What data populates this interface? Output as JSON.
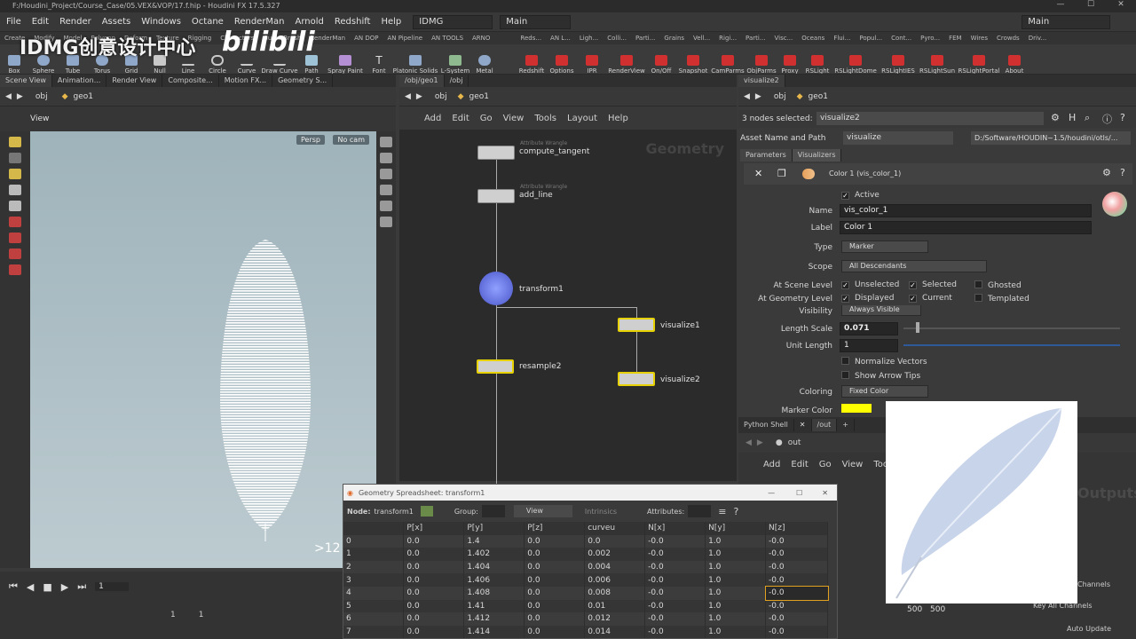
{
  "window": {
    "title": "F:/Houdini_Project/Course_Case/05.VEX&VOP/17.f.hip - Houdini FX 17.5.327",
    "controls": [
      "—",
      "☐",
      "✕"
    ]
  },
  "menubar": {
    "items": [
      "File",
      "Edit",
      "Render",
      "Assets",
      "Windows",
      "Octane",
      "RenderMan",
      "Arnold",
      "Redshift",
      "Help"
    ],
    "desktop": "IDMG",
    "workspace": "Main",
    "right_workspace": "Main"
  },
  "watermark": {
    "left": "IDMG创意设计中心",
    "right": "bilibili"
  },
  "shelf_tabs_left": [
    "Create",
    "Modify",
    "Model",
    "Polygon",
    "Deform",
    "Texture",
    "Rigging",
    "Characters",
    "Guide Brush",
    "RenderMan",
    "AN DOP",
    "AN Pipeline",
    "AN TOOLS",
    "ARNO"
  ],
  "shelf_tabs_right": [
    "Reds...",
    "AN L...",
    "Ligh...",
    "Colli...",
    "Parti...",
    "Grains",
    "Vell...",
    "Rigi...",
    "Parti...",
    "Visc...",
    "Oceans",
    "Flui...",
    "Popul...",
    "Cont...",
    "Pyro...",
    "FEM",
    "Wires",
    "Crowds",
    "Driv..."
  ],
  "shelf_tools_left": [
    "Box",
    "Sphere",
    "Tube",
    "Torus",
    "Grid",
    "Null",
    "Line",
    "Circle",
    "Curve",
    "Draw Curve",
    "Path",
    "Spray Paint",
    "Font",
    "Platonic Solids",
    "L-System",
    "Metal"
  ],
  "shelf_tools_right": [
    "Redshift",
    "Options",
    "IPR",
    "RenderView",
    "On/Off",
    "Snapshot",
    "CamParms",
    "ObjParms",
    "Proxy",
    "RSLight",
    "RSLightDome",
    "RSLightIES",
    "RSLightSun",
    "RSLightPortal",
    "About"
  ],
  "left_pane": {
    "tabs": [
      "Scene View",
      "Animation...",
      "Render View",
      "Composite...",
      "Motion FX...",
      "Geometry S..."
    ],
    "path": [
      "obj",
      "geo1"
    ],
    "view_label": "View",
    "persp": "Persp",
    "cam": "No cam",
    "frame_hint": ">12"
  },
  "node_pane": {
    "tabs": [
      "/obj/geo1",
      "/obj"
    ],
    "path": [
      "obj",
      "geo1"
    ],
    "menu": [
      "Add",
      "Edit",
      "Go",
      "View",
      "Tools",
      "Layout",
      "Help"
    ],
    "context": "Geometry",
    "nodes": [
      {
        "name": "compute_tangent",
        "sub": "Attribute Wrangle"
      },
      {
        "name": "add_line",
        "sub": "Attribute Wrangle"
      },
      {
        "name": "transform1",
        "sub": ""
      },
      {
        "name": "visualize1",
        "sub": ""
      },
      {
        "name": "resample2",
        "sub": ""
      },
      {
        "name": "visualize2",
        "sub": ""
      }
    ]
  },
  "params": {
    "tabs": [
      "visualize2"
    ],
    "path": [
      "obj",
      "geo1"
    ],
    "selected": "3 nodes selected:",
    "selected_node": "visualize2",
    "asset_label": "Asset Name and Path",
    "asset_name": "visualize",
    "asset_path": "D:/Software/HOUDIN~1.5/houdini/otls/...",
    "subtabs": [
      "Parameters",
      "Visualizers"
    ],
    "visualizer": "Color 1 (vis_color_1)",
    "active": "Active",
    "name_label": "Name",
    "name_value": "vis_color_1",
    "label_label": "Label",
    "label_value": "Color 1",
    "type_label": "Type",
    "type_value": "Marker",
    "scope_label": "Scope",
    "scope_value": "All Descendants",
    "scene_label": "At Scene Level",
    "geo_label": "At Geometry Level",
    "checks_scene": [
      "Unselected",
      "Selected",
      "Ghosted"
    ],
    "checks_geo": [
      "Displayed",
      "Current",
      "Templated"
    ],
    "visibility_label": "Visibility",
    "visibility_value": "Always Visible",
    "length_label": "Length Scale",
    "length_value": "0.071",
    "unit_label": "Unit Length",
    "unit_value": "1",
    "normalize": "Normalize Vectors",
    "arrow": "Show Arrow Tips",
    "coloring_label": "Coloring",
    "coloring_value": "Fixed Color",
    "marker_color_label": "Marker Color",
    "marker_color": "#ffff00"
  },
  "python_pane": {
    "tabs": [
      "Python Shell",
      "/out"
    ],
    "path": "out",
    "menu": [
      "Add",
      "Edit",
      "Go",
      "View",
      "Tools"
    ],
    "context": "Outputs",
    "channels": "Channels",
    "key_all": "Key All Channels",
    "auto_update": "Auto Update"
  },
  "spreadsheet": {
    "title": "Geometry Spreadsheet: transform1",
    "node_label": "Node:",
    "node_value": "transform1",
    "group_label": "Group:",
    "view_label": "View",
    "intrinsics": "Intrinsics",
    "attributes_label": "Attributes:",
    "columns": [
      "",
      "P[x]",
      "P[y]",
      "P[z]",
      "curveu",
      "N[x]",
      "N[y]",
      "N[z]"
    ],
    "rows": [
      [
        "0",
        "0.0",
        "1.4",
        "0.0",
        "0.0",
        "-0.0",
        "1.0",
        "-0.0"
      ],
      [
        "1",
        "0.0",
        "1.402",
        "0.0",
        "0.002",
        "-0.0",
        "1.0",
        "-0.0"
      ],
      [
        "2",
        "0.0",
        "1.404",
        "0.0",
        "0.004",
        "-0.0",
        "1.0",
        "-0.0"
      ],
      [
        "3",
        "0.0",
        "1.406",
        "0.0",
        "0.006",
        "-0.0",
        "1.0",
        "-0.0"
      ],
      [
        "4",
        "0.0",
        "1.408",
        "0.0",
        "0.008",
        "-0.0",
        "1.0",
        "-0.0"
      ],
      [
        "5",
        "0.0",
        "1.41",
        "0.0",
        "0.01",
        "-0.0",
        "1.0",
        "-0.0"
      ],
      [
        "6",
        "0.0",
        "1.412",
        "0.0",
        "0.012",
        "-0.0",
        "1.0",
        "-0.0"
      ],
      [
        "7",
        "0.0",
        "1.414",
        "0.0",
        "0.014",
        "-0.0",
        "1.0",
        "-0.0"
      ]
    ]
  },
  "timeline": {
    "frame": "1",
    "start": "1",
    "start2": "1",
    "end": "500",
    "end2": "500"
  }
}
